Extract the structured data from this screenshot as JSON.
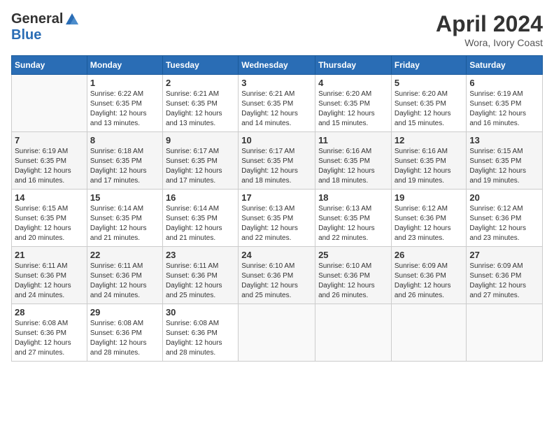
{
  "logo": {
    "general": "General",
    "blue": "Blue"
  },
  "title": "April 2024",
  "subtitle": "Wora, Ivory Coast",
  "weekdays": [
    "Sunday",
    "Monday",
    "Tuesday",
    "Wednesday",
    "Thursday",
    "Friday",
    "Saturday"
  ],
  "weeks": [
    [
      {
        "day": "",
        "info": ""
      },
      {
        "day": "1",
        "info": "Sunrise: 6:22 AM\nSunset: 6:35 PM\nDaylight: 12 hours\nand 13 minutes."
      },
      {
        "day": "2",
        "info": "Sunrise: 6:21 AM\nSunset: 6:35 PM\nDaylight: 12 hours\nand 13 minutes."
      },
      {
        "day": "3",
        "info": "Sunrise: 6:21 AM\nSunset: 6:35 PM\nDaylight: 12 hours\nand 14 minutes."
      },
      {
        "day": "4",
        "info": "Sunrise: 6:20 AM\nSunset: 6:35 PM\nDaylight: 12 hours\nand 15 minutes."
      },
      {
        "day": "5",
        "info": "Sunrise: 6:20 AM\nSunset: 6:35 PM\nDaylight: 12 hours\nand 15 minutes."
      },
      {
        "day": "6",
        "info": "Sunrise: 6:19 AM\nSunset: 6:35 PM\nDaylight: 12 hours\nand 16 minutes."
      }
    ],
    [
      {
        "day": "7",
        "info": "Sunrise: 6:19 AM\nSunset: 6:35 PM\nDaylight: 12 hours\nand 16 minutes."
      },
      {
        "day": "8",
        "info": "Sunrise: 6:18 AM\nSunset: 6:35 PM\nDaylight: 12 hours\nand 17 minutes."
      },
      {
        "day": "9",
        "info": "Sunrise: 6:17 AM\nSunset: 6:35 PM\nDaylight: 12 hours\nand 17 minutes."
      },
      {
        "day": "10",
        "info": "Sunrise: 6:17 AM\nSunset: 6:35 PM\nDaylight: 12 hours\nand 18 minutes."
      },
      {
        "day": "11",
        "info": "Sunrise: 6:16 AM\nSunset: 6:35 PM\nDaylight: 12 hours\nand 18 minutes."
      },
      {
        "day": "12",
        "info": "Sunrise: 6:16 AM\nSunset: 6:35 PM\nDaylight: 12 hours\nand 19 minutes."
      },
      {
        "day": "13",
        "info": "Sunrise: 6:15 AM\nSunset: 6:35 PM\nDaylight: 12 hours\nand 19 minutes."
      }
    ],
    [
      {
        "day": "14",
        "info": "Sunrise: 6:15 AM\nSunset: 6:35 PM\nDaylight: 12 hours\nand 20 minutes."
      },
      {
        "day": "15",
        "info": "Sunrise: 6:14 AM\nSunset: 6:35 PM\nDaylight: 12 hours\nand 21 minutes."
      },
      {
        "day": "16",
        "info": "Sunrise: 6:14 AM\nSunset: 6:35 PM\nDaylight: 12 hours\nand 21 minutes."
      },
      {
        "day": "17",
        "info": "Sunrise: 6:13 AM\nSunset: 6:35 PM\nDaylight: 12 hours\nand 22 minutes."
      },
      {
        "day": "18",
        "info": "Sunrise: 6:13 AM\nSunset: 6:35 PM\nDaylight: 12 hours\nand 22 minutes."
      },
      {
        "day": "19",
        "info": "Sunrise: 6:12 AM\nSunset: 6:36 PM\nDaylight: 12 hours\nand 23 minutes."
      },
      {
        "day": "20",
        "info": "Sunrise: 6:12 AM\nSunset: 6:36 PM\nDaylight: 12 hours\nand 23 minutes."
      }
    ],
    [
      {
        "day": "21",
        "info": "Sunrise: 6:11 AM\nSunset: 6:36 PM\nDaylight: 12 hours\nand 24 minutes."
      },
      {
        "day": "22",
        "info": "Sunrise: 6:11 AM\nSunset: 6:36 PM\nDaylight: 12 hours\nand 24 minutes."
      },
      {
        "day": "23",
        "info": "Sunrise: 6:11 AM\nSunset: 6:36 PM\nDaylight: 12 hours\nand 25 minutes."
      },
      {
        "day": "24",
        "info": "Sunrise: 6:10 AM\nSunset: 6:36 PM\nDaylight: 12 hours\nand 25 minutes."
      },
      {
        "day": "25",
        "info": "Sunrise: 6:10 AM\nSunset: 6:36 PM\nDaylight: 12 hours\nand 26 minutes."
      },
      {
        "day": "26",
        "info": "Sunrise: 6:09 AM\nSunset: 6:36 PM\nDaylight: 12 hours\nand 26 minutes."
      },
      {
        "day": "27",
        "info": "Sunrise: 6:09 AM\nSunset: 6:36 PM\nDaylight: 12 hours\nand 27 minutes."
      }
    ],
    [
      {
        "day": "28",
        "info": "Sunrise: 6:08 AM\nSunset: 6:36 PM\nDaylight: 12 hours\nand 27 minutes."
      },
      {
        "day": "29",
        "info": "Sunrise: 6:08 AM\nSunset: 6:36 PM\nDaylight: 12 hours\nand 28 minutes."
      },
      {
        "day": "30",
        "info": "Sunrise: 6:08 AM\nSunset: 6:36 PM\nDaylight: 12 hours\nand 28 minutes."
      },
      {
        "day": "",
        "info": ""
      },
      {
        "day": "",
        "info": ""
      },
      {
        "day": "",
        "info": ""
      },
      {
        "day": "",
        "info": ""
      }
    ]
  ]
}
